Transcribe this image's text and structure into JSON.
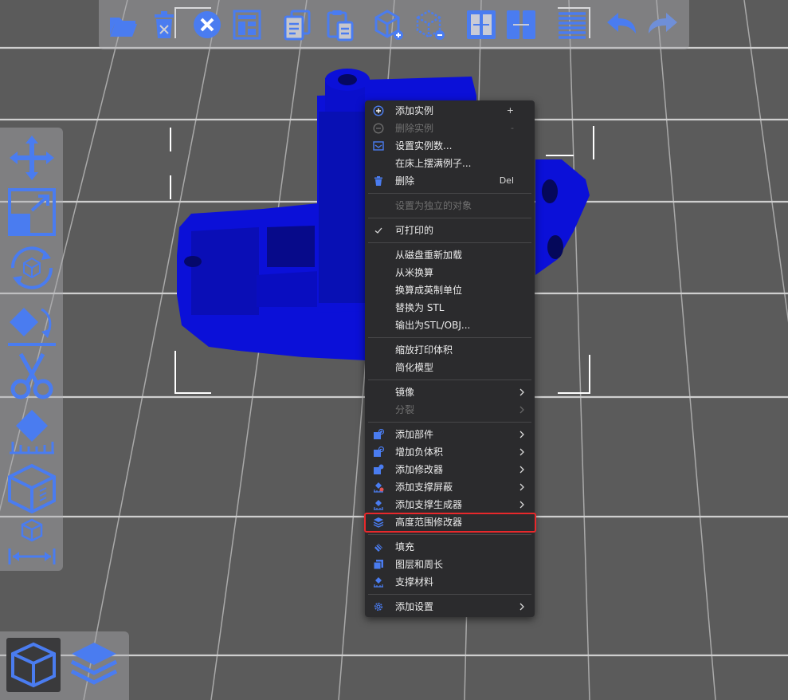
{
  "colors": {
    "accent": "#4a7cf0",
    "model": "#0b10d8",
    "menu_bg": "#2b2b2d",
    "highlight": "#e8282b",
    "grid": "#c8c8c8",
    "background": "#5b5b5b"
  },
  "top_toolbar": {
    "icons": [
      "open-folder-icon",
      "delete-icon",
      "delete-all-icon",
      "arrange-icon",
      "copy-icon",
      "paste-icon",
      "add-instance-icon",
      "remove-instance-icon",
      "split-to-objects-icon",
      "split-to-parts-icon",
      "layer-editing-icon",
      "undo-icon",
      "redo-icon"
    ]
  },
  "left_toolbar": {
    "icons": [
      "move-icon",
      "scale-icon",
      "rotate-icon",
      "place-on-face-icon",
      "cut-icon",
      "paint-support-icon",
      "seam-paint-icon",
      "measure-icon"
    ]
  },
  "view_toolbar": {
    "icons": [
      "3d-view-icon",
      "preview-layers-icon"
    ]
  },
  "context_menu": {
    "items": [
      {
        "label": "添加实例",
        "shortcut": "+",
        "icon": "plus-circle-icon",
        "disabled": false
      },
      {
        "label": "删除实例",
        "shortcut": "-",
        "icon": "minus-circle-icon",
        "disabled": true
      },
      {
        "label": "设置实例数...",
        "shortcut": "",
        "icon": "instances-icon",
        "disabled": false
      },
      {
        "label": "在床上摆满例子...",
        "shortcut": "",
        "icon": "",
        "disabled": false
      },
      {
        "label": "删除",
        "shortcut": "Del",
        "icon": "trash-icon",
        "disabled": false
      },
      {
        "label": "设置为独立的对象",
        "shortcut": "",
        "icon": "",
        "disabled": true
      },
      {
        "label": "可打印的",
        "shortcut": "",
        "icon": "check-icon",
        "disabled": false
      },
      {
        "label": "从磁盘重新加载",
        "shortcut": "",
        "icon": "",
        "disabled": false
      },
      {
        "label": "从米换算",
        "shortcut": "",
        "icon": "",
        "disabled": false
      },
      {
        "label": "换算成英制单位",
        "shortcut": "",
        "icon": "",
        "disabled": false
      },
      {
        "label": "替换为 STL",
        "shortcut": "",
        "icon": "",
        "disabled": false
      },
      {
        "label": "输出为STL/OBJ...",
        "shortcut": "",
        "icon": "",
        "disabled": false
      },
      {
        "label": "缩放打印体积",
        "shortcut": "",
        "icon": "",
        "disabled": false
      },
      {
        "label": "简化模型",
        "shortcut": "",
        "icon": "",
        "disabled": false
      },
      {
        "label": "镜像",
        "shortcut": "",
        "icon": "",
        "disabled": false
      },
      {
        "label": "分裂",
        "shortcut": "",
        "icon": "",
        "disabled": true
      },
      {
        "label": "添加部件",
        "shortcut": "",
        "icon": "add-part-icon",
        "disabled": false
      },
      {
        "label": "增加负体积",
        "shortcut": "",
        "icon": "negative-volume-icon",
        "disabled": false
      },
      {
        "label": "添加修改器",
        "shortcut": "",
        "icon": "modifier-icon",
        "disabled": false
      },
      {
        "label": "添加支撑屏蔽",
        "shortcut": "",
        "icon": "support-blocker-icon",
        "disabled": false
      },
      {
        "label": "添加支撑生成器",
        "shortcut": "",
        "icon": "support-enforcer-icon",
        "disabled": false
      },
      {
        "label": "高度范围修改器",
        "shortcut": "",
        "icon": "height-range-icon",
        "disabled": false,
        "highlighted": true
      },
      {
        "label": "填充",
        "shortcut": "",
        "icon": "infill-icon",
        "disabled": false
      },
      {
        "label": "图层和周长",
        "shortcut": "",
        "icon": "layers-perimeters-icon",
        "disabled": false
      },
      {
        "label": "支撑材料",
        "shortcut": "",
        "icon": "support-material-icon",
        "disabled": false
      },
      {
        "label": "添加设置",
        "shortcut": "",
        "icon": "gear-icon",
        "disabled": false
      }
    ]
  }
}
